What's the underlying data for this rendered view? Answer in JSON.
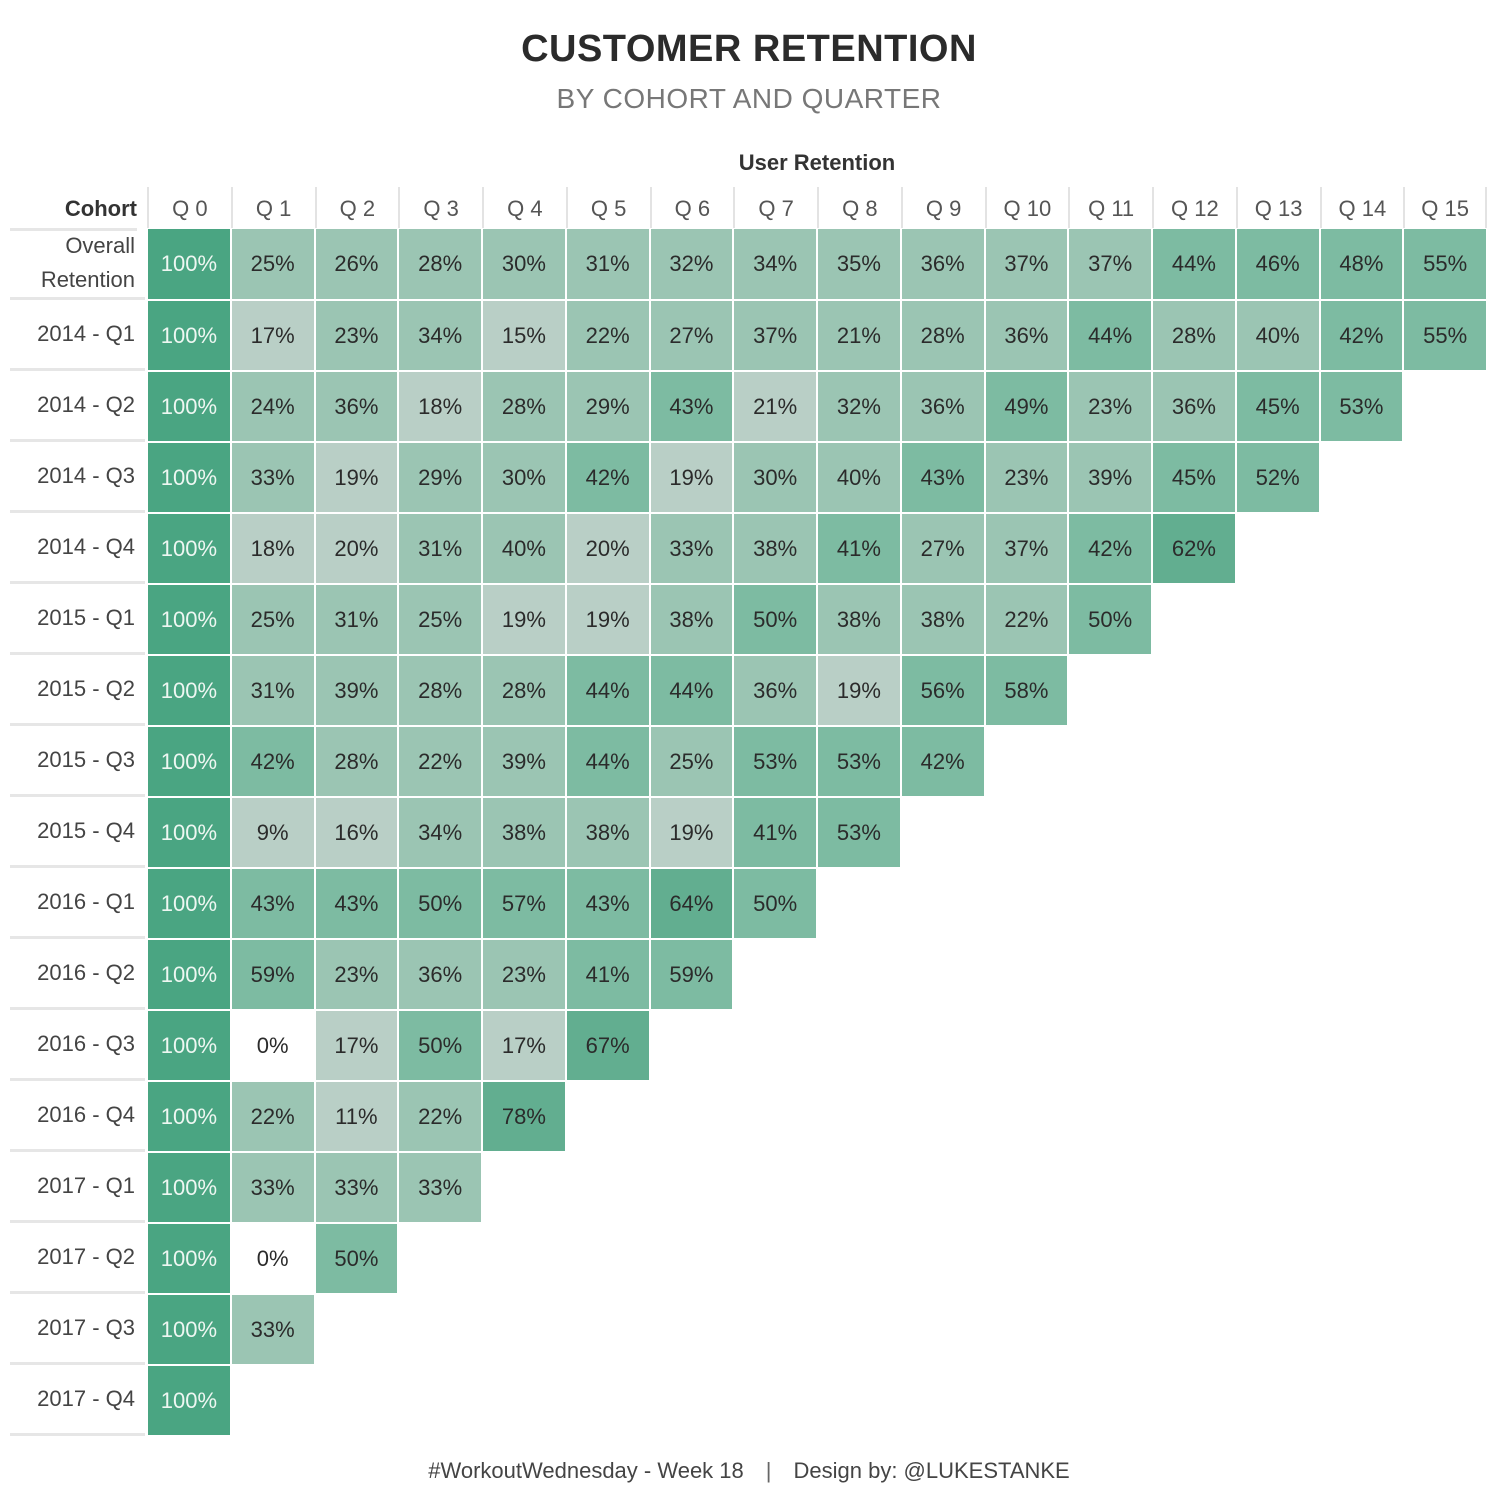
{
  "header": {
    "title": "CUSTOMER RETENTION",
    "subtitle": "BY COHORT AND QUARTER"
  },
  "footer": {
    "left": "#WorkoutWednesday - Week 18",
    "separator": "|",
    "right": "Design by: @LUKESTANKE"
  },
  "colors": {
    "level0": "#ffffff",
    "level1": "#b9cfc6",
    "level2": "#9bc5b3",
    "level3": "#7dbba2",
    "level4": "#62ae90",
    "level5": "#4aa582"
  },
  "chart_data": {
    "type": "heatmap",
    "title": "CUSTOMER RETENTION",
    "subtitle": "BY COHORT AND QUARTER",
    "column_axis_title": "User Retention",
    "row_axis_title": "Cohort",
    "columns": [
      "Q 0",
      "Q 1",
      "Q 2",
      "Q 3",
      "Q 4",
      "Q 5",
      "Q 6",
      "Q 7",
      "Q 8",
      "Q 9",
      "Q 10",
      "Q 11",
      "Q 12",
      "Q 13",
      "Q 14",
      "Q 15"
    ],
    "rows": [
      {
        "label": "Overall Retention",
        "values": [
          100,
          25,
          26,
          28,
          30,
          31,
          32,
          34,
          35,
          36,
          37,
          37,
          44,
          46,
          48,
          55
        ],
        "levels": [
          5,
          2,
          2,
          2,
          2,
          2,
          2,
          2,
          2,
          2,
          2,
          2,
          3,
          3,
          3,
          3
        ]
      },
      {
        "label": "2014 - Q1",
        "values": [
          100,
          17,
          23,
          34,
          15,
          22,
          27,
          37,
          21,
          28,
          36,
          44,
          28,
          40,
          42,
          55
        ],
        "levels": [
          5,
          1,
          2,
          2,
          1,
          2,
          2,
          2,
          2,
          2,
          2,
          3,
          2,
          2,
          3,
          3
        ]
      },
      {
        "label": "2014 - Q2",
        "values": [
          100,
          24,
          36,
          18,
          28,
          29,
          43,
          21,
          32,
          36,
          49,
          23,
          36,
          45,
          53
        ],
        "levels": [
          5,
          2,
          2,
          1,
          2,
          2,
          3,
          1,
          2,
          2,
          3,
          2,
          2,
          3,
          3
        ]
      },
      {
        "label": "2014 - Q3",
        "values": [
          100,
          33,
          19,
          29,
          30,
          42,
          19,
          30,
          40,
          43,
          23,
          39,
          45,
          52
        ],
        "levels": [
          5,
          2,
          1,
          2,
          2,
          3,
          1,
          2,
          2,
          3,
          2,
          2,
          3,
          3
        ]
      },
      {
        "label": "2014 - Q4",
        "values": [
          100,
          18,
          20,
          31,
          40,
          20,
          33,
          38,
          41,
          27,
          37,
          42,
          62
        ],
        "levels": [
          5,
          1,
          1,
          2,
          2,
          1,
          2,
          2,
          3,
          2,
          2,
          3,
          4
        ]
      },
      {
        "label": "2015 - Q1",
        "values": [
          100,
          25,
          31,
          25,
          19,
          19,
          38,
          50,
          38,
          38,
          22,
          50
        ],
        "levels": [
          5,
          2,
          2,
          2,
          1,
          1,
          2,
          3,
          2,
          2,
          2,
          3
        ]
      },
      {
        "label": "2015 - Q2",
        "values": [
          100,
          31,
          39,
          28,
          28,
          44,
          44,
          36,
          19,
          56,
          58
        ],
        "levels": [
          5,
          2,
          2,
          2,
          2,
          3,
          3,
          2,
          1,
          3,
          3
        ]
      },
      {
        "label": "2015 - Q3",
        "values": [
          100,
          42,
          28,
          22,
          39,
          44,
          25,
          53,
          53,
          42
        ],
        "levels": [
          5,
          3,
          2,
          2,
          2,
          3,
          2,
          3,
          3,
          3
        ]
      },
      {
        "label": "2015 - Q4",
        "values": [
          100,
          9,
          16,
          34,
          38,
          38,
          19,
          41,
          53
        ],
        "levels": [
          5,
          1,
          1,
          2,
          2,
          2,
          1,
          3,
          3
        ]
      },
      {
        "label": "2016 - Q1",
        "values": [
          100,
          43,
          43,
          50,
          57,
          43,
          64,
          50
        ],
        "levels": [
          5,
          3,
          3,
          3,
          3,
          3,
          4,
          3
        ]
      },
      {
        "label": "2016 - Q2",
        "values": [
          100,
          59,
          23,
          36,
          23,
          41,
          59
        ],
        "levels": [
          5,
          3,
          2,
          2,
          2,
          3,
          3
        ]
      },
      {
        "label": "2016 - Q3",
        "values": [
          100,
          0,
          17,
          50,
          17,
          67
        ],
        "levels": [
          5,
          0,
          1,
          3,
          1,
          4
        ]
      },
      {
        "label": "2016 - Q4",
        "values": [
          100,
          22,
          11,
          22,
          78
        ],
        "levels": [
          5,
          2,
          1,
          2,
          4
        ]
      },
      {
        "label": "2017 - Q1",
        "values": [
          100,
          33,
          33,
          33
        ],
        "levels": [
          5,
          2,
          2,
          2
        ]
      },
      {
        "label": "2017 - Q2",
        "values": [
          100,
          0,
          50
        ],
        "levels": [
          5,
          0,
          3
        ]
      },
      {
        "label": "2017 - Q3",
        "values": [
          100,
          33
        ],
        "levels": [
          5,
          2
        ]
      },
      {
        "label": "2017 - Q4",
        "values": [
          100
        ],
        "levels": [
          5
        ]
      }
    ],
    "value_format": "percent",
    "legend": "none"
  }
}
